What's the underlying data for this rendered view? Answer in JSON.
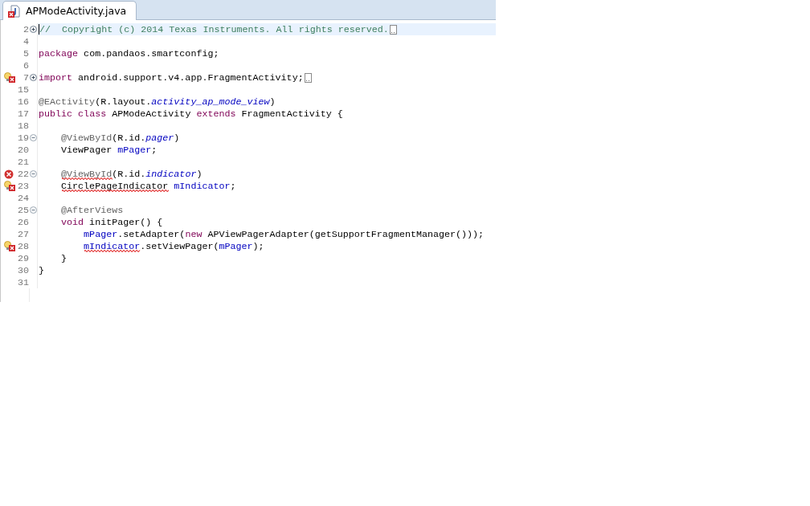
{
  "tab": {
    "title": "APModeActivity.java",
    "has_errors": true
  },
  "lines": [
    {
      "number": "2",
      "collapsed": true,
      "expanded": false,
      "error": false,
      "quick_fix": false,
      "current": true,
      "folded": true,
      "tokens": [
        {
          "text": "//  Copyright (c) 2014 Texas Instruments. All rights reserved.",
          "kind": "comment"
        }
      ]
    },
    {
      "number": "4",
      "collapsed": false,
      "expanded": false,
      "error": false,
      "quick_fix": false,
      "current": false,
      "folded": false
    },
    {
      "number": "5",
      "collapsed": false,
      "expanded": false,
      "error": false,
      "quick_fix": false,
      "current": false,
      "folded": false,
      "tokens": [
        {
          "text": "package",
          "kind": "keyword"
        },
        {
          "text": " com.pandaos.smartconfig;",
          "kind": "plain"
        }
      ]
    },
    {
      "number": "6",
      "collapsed": false,
      "expanded": false,
      "error": false,
      "quick_fix": false,
      "current": false,
      "folded": false
    },
    {
      "number": "7",
      "collapsed": true,
      "expanded": false,
      "error": true,
      "quick_fix": true,
      "current": false,
      "folded": true,
      "tokens": [
        {
          "text": "import",
          "kind": "keyword"
        },
        {
          "text": " android.support.v4.app.FragmentActivity;",
          "kind": "plain"
        }
      ]
    },
    {
      "number": "15",
      "collapsed": false,
      "expanded": false,
      "error": false,
      "quick_fix": false,
      "current": false,
      "folded": false
    },
    {
      "number": "16",
      "collapsed": false,
      "expanded": false,
      "error": false,
      "quick_fix": false,
      "current": false,
      "folded": false,
      "tokens": [
        {
          "text": "@EActivity",
          "kind": "annotation"
        },
        {
          "text": "(R.layout.",
          "kind": "plain"
        },
        {
          "text": "activity_ap_mode_view",
          "kind": "constant"
        },
        {
          "text": ")",
          "kind": "plain"
        }
      ]
    },
    {
      "number": "17",
      "collapsed": false,
      "expanded": false,
      "error": false,
      "quick_fix": false,
      "current": false,
      "folded": false,
      "tokens": [
        {
          "text": "public",
          "kind": "keyword"
        },
        {
          "text": " class",
          "kind": "keyword"
        },
        {
          "text": " APModeActivity",
          "kind": "plain"
        },
        {
          "text": " extends",
          "kind": "keyword"
        },
        {
          "text": " FragmentActivity {",
          "kind": "plain"
        }
      ]
    },
    {
      "number": "18",
      "collapsed": false,
      "expanded": false,
      "error": false,
      "quick_fix": false,
      "current": false,
      "folded": false
    },
    {
      "number": "19",
      "collapsed": false,
      "expanded": true,
      "error": false,
      "quick_fix": false,
      "current": false,
      "folded": false,
      "tokens": [
        {
          "text": "    @ViewById",
          "kind": "annotation"
        },
        {
          "text": "(R.id.",
          "kind": "plain"
        },
        {
          "text": "pager",
          "kind": "constant"
        },
        {
          "text": ")",
          "kind": "plain"
        }
      ]
    },
    {
      "number": "20",
      "collapsed": false,
      "expanded": false,
      "error": false,
      "quick_fix": false,
      "current": false,
      "folded": false,
      "tokens": [
        {
          "text": "    ViewPager",
          "kind": "plain"
        },
        {
          "text": " mPager",
          "kind": "field"
        },
        {
          "text": ";",
          "kind": "plain"
        }
      ]
    },
    {
      "number": "21",
      "collapsed": false,
      "expanded": false,
      "error": false,
      "quick_fix": false,
      "current": false,
      "folded": false
    },
    {
      "number": "22",
      "collapsed": false,
      "expanded": true,
      "error": true,
      "quick_fix": false,
      "current": false,
      "folded": false,
      "tokens": [
        {
          "text": "    @ViewById",
          "kind": "annotation",
          "error": true
        },
        {
          "text": "(R.id.",
          "kind": "plain"
        },
        {
          "text": "indicator",
          "kind": "constant"
        },
        {
          "text": ")",
          "kind": "plain"
        }
      ]
    },
    {
      "number": "23",
      "collapsed": false,
      "expanded": false,
      "error": true,
      "quick_fix": true,
      "current": false,
      "folded": false,
      "tokens": [
        {
          "text": "    CirclePageIndicator",
          "kind": "plain",
          "error": true
        },
        {
          "text": " mIndicator",
          "kind": "field"
        },
        {
          "text": ";",
          "kind": "plain"
        }
      ]
    },
    {
      "number": "24",
      "collapsed": false,
      "expanded": false,
      "error": false,
      "quick_fix": false,
      "current": false,
      "folded": false
    },
    {
      "number": "25",
      "collapsed": false,
      "expanded": true,
      "error": false,
      "quick_fix": false,
      "current": false,
      "folded": false,
      "tokens": [
        {
          "text": "    @AfterViews",
          "kind": "annotation"
        }
      ]
    },
    {
      "number": "26",
      "collapsed": false,
      "expanded": false,
      "error": false,
      "quick_fix": false,
      "current": false,
      "folded": false,
      "tokens": [
        {
          "text": "    void",
          "kind": "keyword"
        },
        {
          "text": " initPager() {",
          "kind": "plain"
        }
      ]
    },
    {
      "number": "27",
      "collapsed": false,
      "expanded": false,
      "error": false,
      "quick_fix": false,
      "current": false,
      "folded": false,
      "tokens": [
        {
          "text": "        mPager",
          "kind": "field"
        },
        {
          "text": ".setAdapter(",
          "kind": "plain"
        },
        {
          "text": "new",
          "kind": "keyword"
        },
        {
          "text": " APViewPagerAdapter(getSupportFragmentManager()));",
          "kind": "plain"
        }
      ]
    },
    {
      "number": "28",
      "collapsed": false,
      "expanded": false,
      "error": true,
      "quick_fix": true,
      "current": false,
      "folded": false,
      "tokens": [
        {
          "text": "        mIndicator",
          "kind": "field",
          "error": true
        },
        {
          "text": ".setViewPager(",
          "kind": "plain"
        },
        {
          "text": "mPager",
          "kind": "field"
        },
        {
          "text": ");",
          "kind": "plain"
        }
      ]
    },
    {
      "number": "29",
      "collapsed": false,
      "expanded": false,
      "error": false,
      "quick_fix": false,
      "current": false,
      "folded": false,
      "tokens": [
        {
          "text": "    }",
          "kind": "plain"
        }
      ]
    },
    {
      "number": "30",
      "collapsed": false,
      "expanded": false,
      "error": false,
      "quick_fix": false,
      "current": false,
      "folded": false,
      "tokens": [
        {
          "text": "}",
          "kind": "plain"
        }
      ]
    },
    {
      "number": "31",
      "collapsed": false,
      "expanded": false,
      "error": false,
      "quick_fix": false,
      "current": false,
      "folded": false
    }
  ]
}
